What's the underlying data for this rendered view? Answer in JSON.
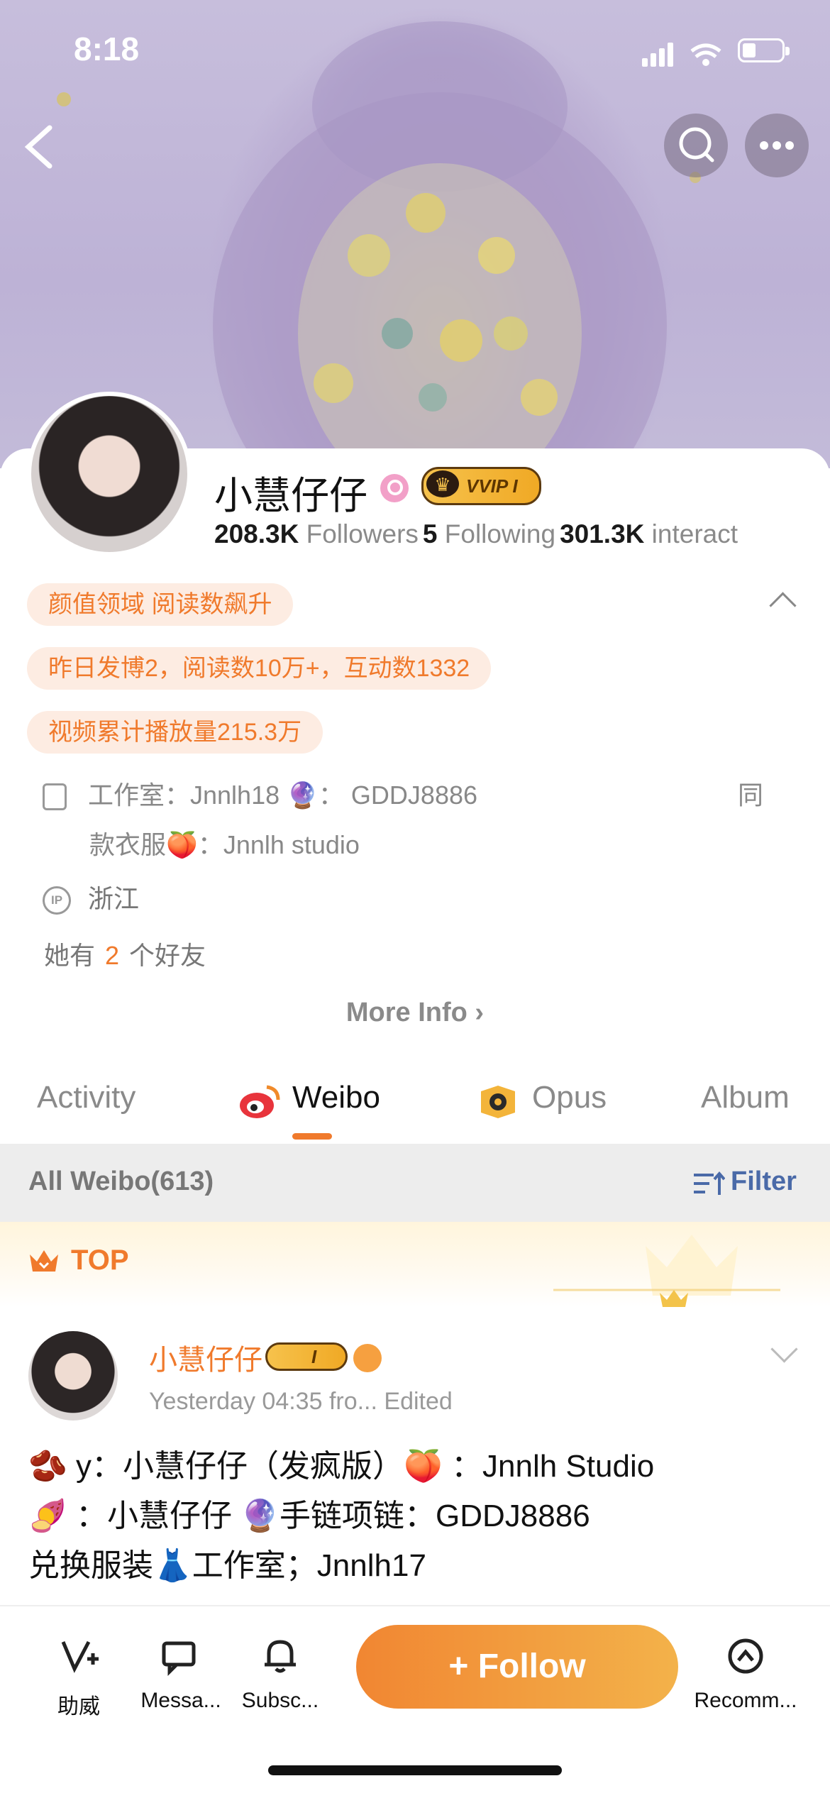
{
  "status_bar": {
    "time": "8:18"
  },
  "profile": {
    "name": "小慧仔仔",
    "vip_label": "VVIP I",
    "followers_count": "208.3K",
    "followers_label": "Followers",
    "following_count": "5",
    "following_label": "Following",
    "interactions_count": "301.3K",
    "interactions_label": "interact"
  },
  "tags": [
    "颜值领域 阅读数飙升",
    "昨日发博2，阅读数10万+，互动数1332",
    "视频累计播放量215.3万"
  ],
  "bio": {
    "line1": "工作室：Jnnlh18 🔮： GDDJ8886",
    "line1_suffix": "同",
    "line2": "款衣服🍑：Jnnlh studio",
    "ip_badge": "IP",
    "ip_location": "浙江",
    "friends_prefix": "她有",
    "friends_count": "2",
    "friends_suffix": "个好友",
    "more_info": "More Info ›"
  },
  "tabs": [
    {
      "label": "Activity"
    },
    {
      "label": "Weibo",
      "active": true
    },
    {
      "label": "Opus"
    },
    {
      "label": "Album"
    }
  ],
  "filter_bar": {
    "all_label": "All Weibo(613)",
    "filter_label": "Filter"
  },
  "top_label": "TOP",
  "post": {
    "author": "小慧仔仔",
    "vip_badge": "I",
    "meta": "Yesterday 04:35  fro...  Edited",
    "lines": [
      "🫘 y：小慧仔仔（发疯版）🍑 ：Jnnlh Studio",
      "🍠 ：小慧仔仔 🔮手链项链：GDDJ8886",
      "兑换服装👗工作室；Jnnlh17"
    ]
  },
  "bottom_bar": {
    "assist": "助威",
    "messages": "Messa...",
    "subscribe": "Subsc...",
    "follow": "+ Follow",
    "recommend": "Recomm..."
  },
  "colors": {
    "accent": "#f07a2c",
    "link_blue": "#4a6aa8"
  }
}
